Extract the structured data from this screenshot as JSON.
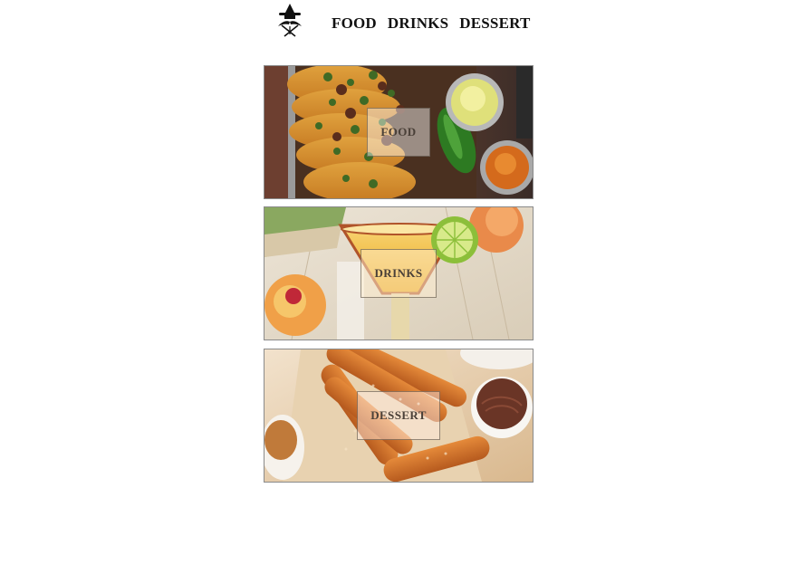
{
  "brand": {
    "logo_icon": "sombrero-mustache-logo-icon"
  },
  "nav": {
    "items": [
      {
        "label": "FOOD"
      },
      {
        "label": "DRINKS"
      },
      {
        "label": "DESSERT"
      }
    ]
  },
  "cards": [
    {
      "label": "FOOD",
      "image": "tacos-photo"
    },
    {
      "label": "DRINKS",
      "image": "margarita-photo"
    },
    {
      "label": "DESSERT",
      "image": "churros-photo"
    }
  ],
  "colors": {
    "text": "#111111",
    "card_border": "#8a8a8a",
    "label_text": "#4a4038"
  }
}
